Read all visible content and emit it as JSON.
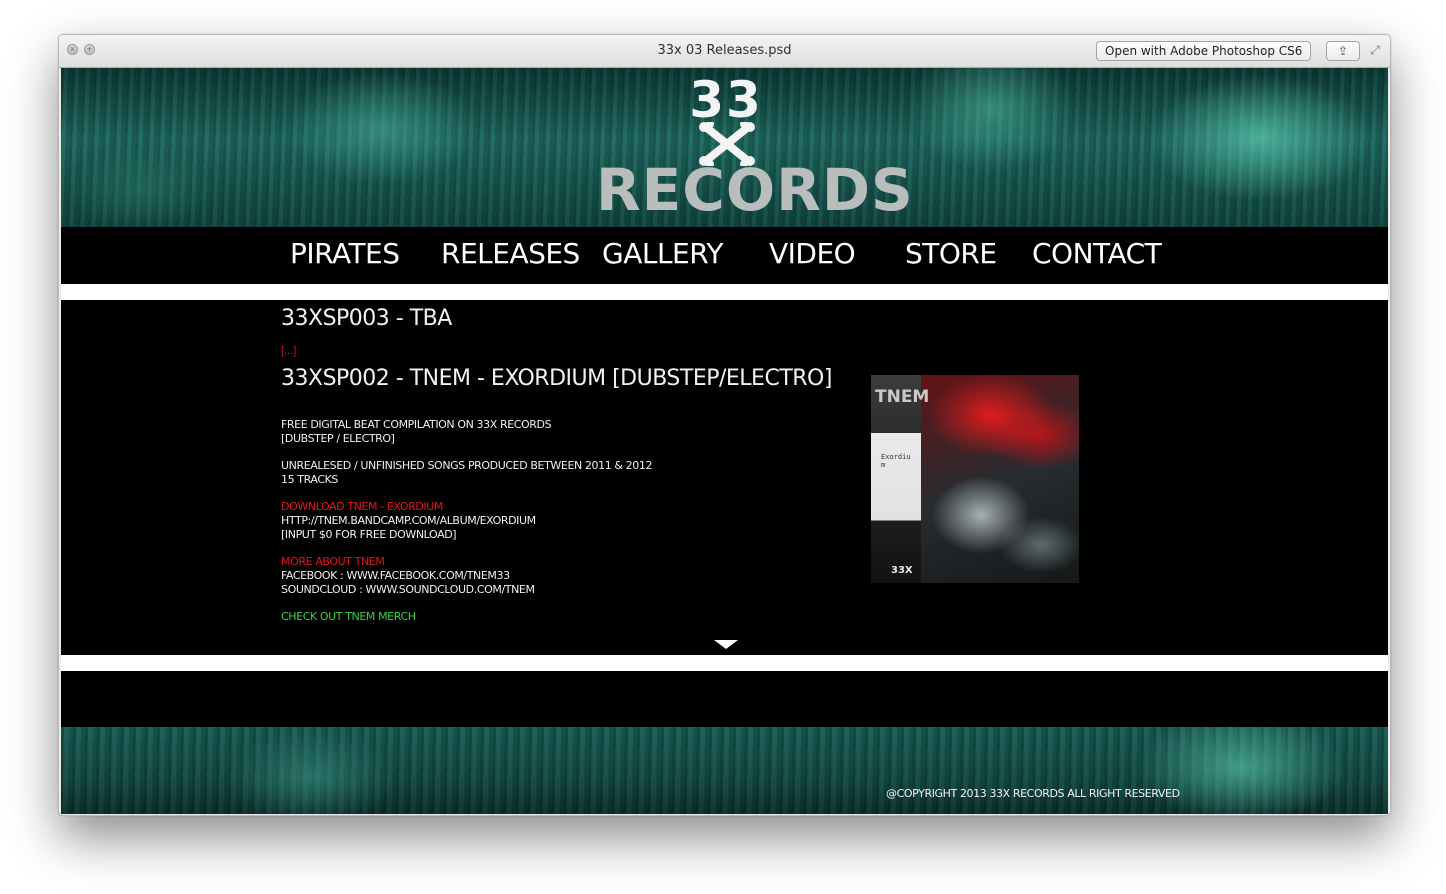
{
  "window": {
    "title": "33x 03 Releases.psd",
    "open_with_label": "Open with Adobe Photoshop CS6",
    "close_glyph": "×",
    "zoom_glyph": "+",
    "share_glyph": "⇪",
    "fullscreen_glyph": "⤢"
  },
  "site": {
    "logo": {
      "top": "33",
      "bottom": "RECORDS"
    },
    "nav": [
      "PIRATES",
      "RELEASES",
      "GALLERY",
      "VIDEO",
      "STORE",
      "CONTACT"
    ],
    "releases": [
      {
        "title": "33XSP003 - TBA",
        "teaser": "[...]"
      },
      {
        "title": "33XSP002 - TNEM - EXORDIUM [DUBSTEP/ELECTRO]",
        "lines": {
          "l1": "FREE DIGITAL BEAT COMPILATION ON 33X RECORDS",
          "l2": "[DUBSTEP / ELECTRO]",
          "l3": "UNREALESED / UNFINISHED SONGS PRODUCED BETWEEN 2011 & 2012",
          "l4": "15 TRACKS",
          "download_link": "DOWNLOAD TNEM - EXORDIUM",
          "l5": "HTTP://TNEM.BANDCAMP.COM/ALBUM/EXORDIUM",
          "l6": "[INPUT $0 FOR FREE DOWNLOAD]",
          "more_link": "MORE ABOUT TNEM",
          "l7": "FACEBOOK : WWW.FACEBOOK.COM/TNEM33",
          "l8": "SOUNDCLOUD : WWW.SOUNDCLOUD.COM/TNEM",
          "merch_link": "CHECK OUT TNEM MERCH"
        },
        "cover": {
          "brand": "TNEM",
          "title": "Exordium",
          "label": "33X"
        }
      }
    ],
    "copyright": "@COPYRIGHT 2013 33X RECORDS ALL RIGHT RESERVED"
  },
  "colors": {
    "accent_red": "#e5141f",
    "accent_green": "#33d641",
    "teal": "#1e6a61"
  }
}
